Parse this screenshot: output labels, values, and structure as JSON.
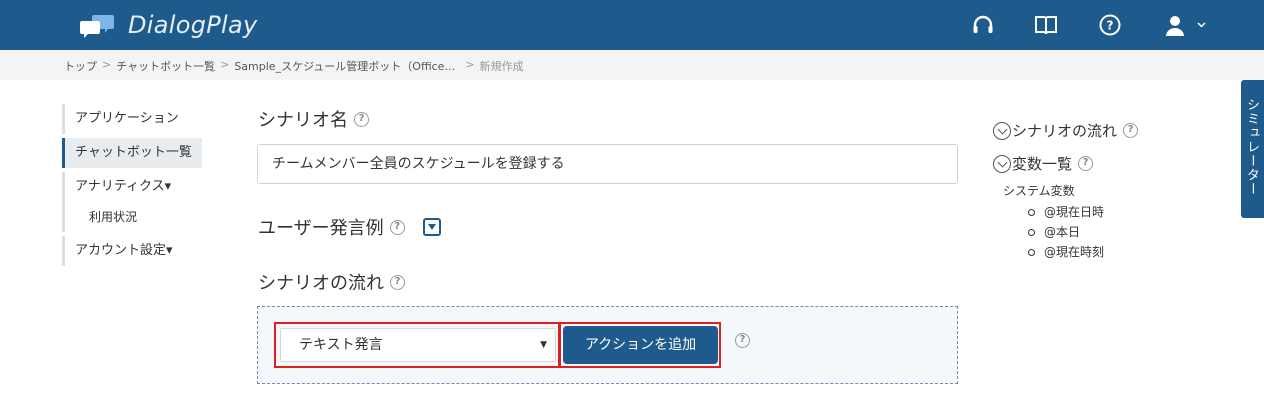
{
  "header": {
    "app_name": "DialogPlay",
    "icons": [
      "headset-icon",
      "book-icon",
      "help-icon",
      "user-icon",
      "chevron-down-icon"
    ]
  },
  "breadcrumb": {
    "items": [
      "トップ",
      "チャットボット一覧",
      "Sample_スケジュール管理ボット（Office…"
    ],
    "current": "新規作成",
    "separator": ">"
  },
  "sidebar": {
    "items": [
      {
        "label": "アプリケーション"
      },
      {
        "label": "チャットボット一覧",
        "active": true
      },
      {
        "label": "アナリティクス▾"
      },
      {
        "label": "利用状況"
      },
      {
        "label": "アカウント設定▾"
      }
    ]
  },
  "main": {
    "scenario_name_label": "シナリオ名",
    "scenario_name_value": "チームメンバー全員のスケジュールを登録する",
    "utterance_label": "ユーザー発言例",
    "flow_label": "シナリオの流れ",
    "action_select_value": "テキスト発言",
    "add_action_button": "アクションを追加",
    "help_glyph": "?"
  },
  "right_panel": {
    "flow_link": "シナリオの流れ",
    "variables_link": "変数一覧",
    "system_vars_label": "システム変数",
    "system_vars": [
      "@現在日時",
      "@本日",
      "@現在時刻"
    ]
  },
  "simulator_tab": "シミュレーター",
  "colors": {
    "primary": "#1f5a8c",
    "highlight": "#e02020",
    "breadcrumb_bg": "#f2f4f6"
  }
}
